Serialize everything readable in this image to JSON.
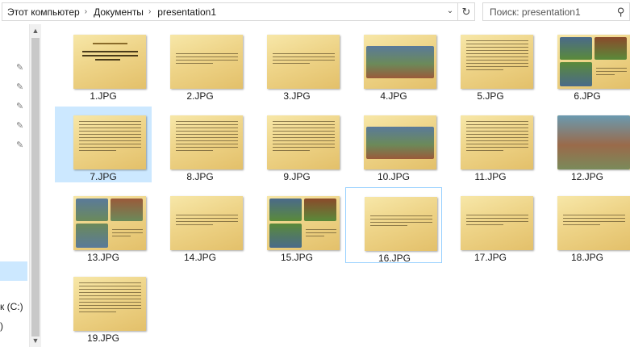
{
  "breadcrumb": [
    "Этот компьютер",
    "Документы",
    "presentation1"
  ],
  "search": {
    "placeholder": "Поиск: presentation1"
  },
  "nav": {
    "drive_label": "к (C:)",
    "drive2_label": ")"
  },
  "files": [
    {
      "name": "1.JPG",
      "kind": "title"
    },
    {
      "name": "2.JPG",
      "kind": "text"
    },
    {
      "name": "3.JPG",
      "kind": "text"
    },
    {
      "name": "4.JPG",
      "kind": "picture-wide"
    },
    {
      "name": "5.JPG",
      "kind": "text-dense"
    },
    {
      "name": "6.JPG",
      "kind": "picture-collage"
    },
    {
      "name": "7.JPG",
      "kind": "text-dense"
    },
    {
      "name": "8.JPG",
      "kind": "text-dense"
    },
    {
      "name": "9.JPG",
      "kind": "text-dense"
    },
    {
      "name": "10.JPG",
      "kind": "picture-wide"
    },
    {
      "name": "11.JPG",
      "kind": "text-dense"
    },
    {
      "name": "12.JPG",
      "kind": "picture-full"
    },
    {
      "name": "13.JPG",
      "kind": "picture-collage"
    },
    {
      "name": "14.JPG",
      "kind": "text"
    },
    {
      "name": "15.JPG",
      "kind": "picture-collage"
    },
    {
      "name": "16.JPG",
      "kind": "text"
    },
    {
      "name": "17.JPG",
      "kind": "text"
    },
    {
      "name": "18.JPG",
      "kind": "text"
    },
    {
      "name": "19.JPG",
      "kind": "text-dense"
    }
  ],
  "selected_file": "7.JPG",
  "hovered_file": "16.JPG",
  "colors": {
    "selection": "#cce8ff",
    "hover_border": "#99d1ff",
    "slide_gold": "#eed488"
  }
}
